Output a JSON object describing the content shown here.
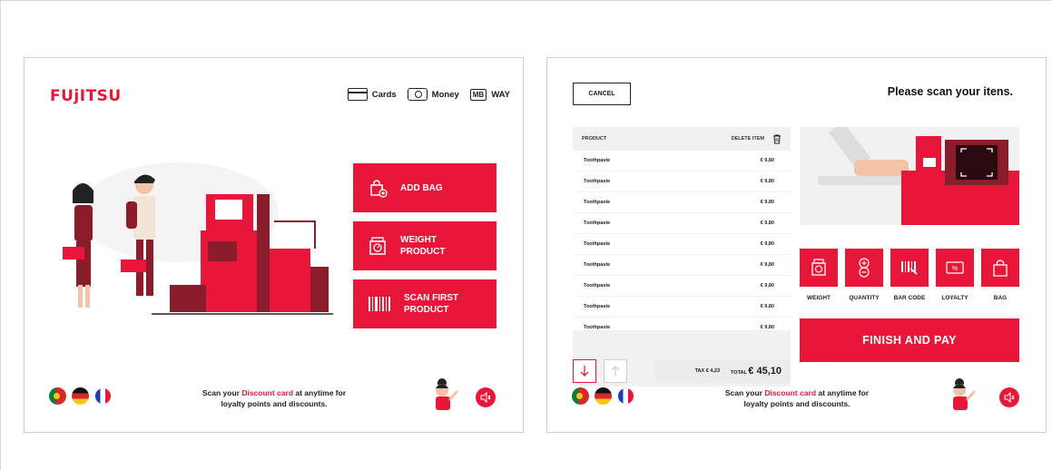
{
  "left_screen": {
    "logo": "FUjITSU",
    "payment_methods": [
      {
        "label": "Cards",
        "icon": "card-icon"
      },
      {
        "label": "Money",
        "icon": "money-icon"
      },
      {
        "label": "WAY",
        "icon": "mb-way-icon",
        "badge": "MB"
      }
    ],
    "actions": [
      {
        "label": "ADD BAG",
        "icon": "bag-add-icon"
      },
      {
        "label": "WEIGHT PRODUCT",
        "icon": "scale-icon"
      },
      {
        "label": "SCAN FIRST PRODUCT",
        "icon": "barcode-icon"
      }
    ],
    "footer": {
      "discount_prefix": "Scan your ",
      "discount_highlight": "Discount card",
      "discount_suffix": " at anytime for loyalty points and discounts."
    }
  },
  "right_screen": {
    "cancel_label": "CANCEL",
    "prompt": "Please scan your itens.",
    "table": {
      "col_product": "PRODUCT",
      "col_delete": "DELETE ITEM",
      "rows": [
        {
          "name": "Toothpaste",
          "price": "€ 9,80"
        },
        {
          "name": "Toothpaste",
          "price": "€ 9,80"
        },
        {
          "name": "Toothpaste",
          "price": "€ 9,80"
        },
        {
          "name": "Toothpaste",
          "price": "€ 9,80"
        },
        {
          "name": "Toothpaste",
          "price": "€ 9,80"
        },
        {
          "name": "Toothpaste",
          "price": "€ 9,80"
        },
        {
          "name": "Toothpaste",
          "price": "€ 9,80"
        },
        {
          "name": "Toothpaste",
          "price": "€ 9,80"
        },
        {
          "name": "Toothpaste",
          "price": "€ 9,80"
        }
      ]
    },
    "tax_label": "TAX",
    "tax_value": "€ 4,23",
    "total_label": "TOTAL",
    "total_value": "€ 45,10",
    "options": [
      {
        "label": "WEIGHT",
        "icon": "scale-icon"
      },
      {
        "label": "QUANTITY",
        "icon": "plus-minus-icon"
      },
      {
        "label": "BAR CODE",
        "icon": "barcode-icon"
      },
      {
        "label": "LOYALTY",
        "icon": "loyalty-card-icon"
      },
      {
        "label": "BAG",
        "icon": "bag-icon"
      }
    ],
    "finish_label": "FINISH AND PAY",
    "footer": {
      "discount_prefix": "Scan your ",
      "discount_highlight": "Discount card",
      "discount_suffix": " at anytime for loyalty points and discounts."
    }
  },
  "colors": {
    "accent": "#e8173a",
    "dark_red": "#8a1c2b",
    "panel_gray": "#f1f1f1"
  },
  "languages": [
    "Portuguese",
    "German",
    "French"
  ]
}
